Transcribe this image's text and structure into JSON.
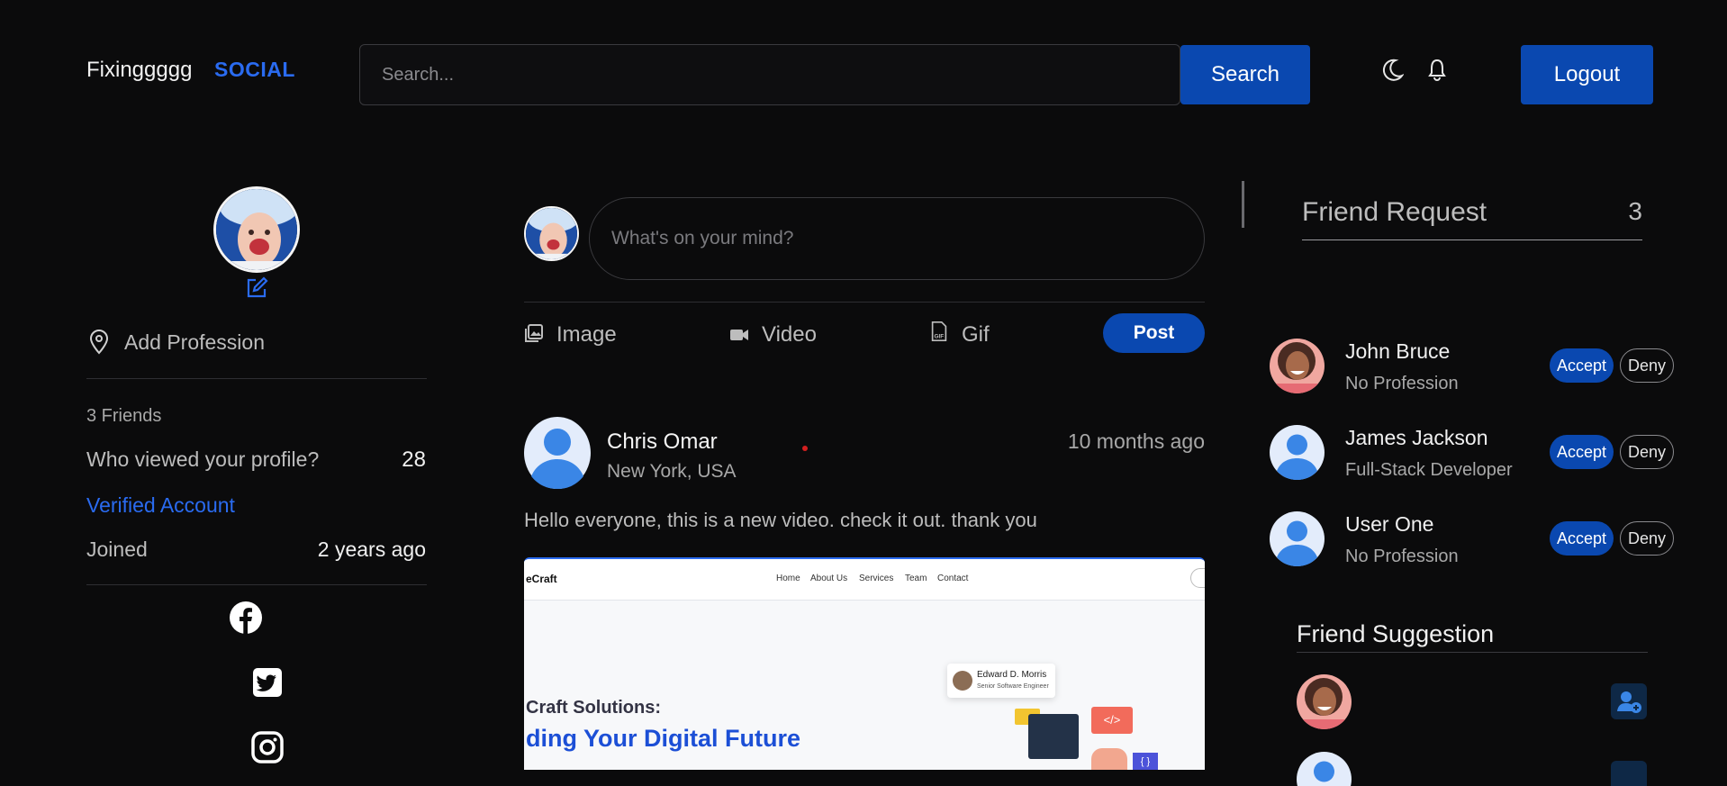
{
  "header": {
    "brand": "Fixinggggg",
    "brand_accent": "SOCIAL",
    "search_placeholder": "Search...",
    "search_button": "Search",
    "logout_button": "Logout"
  },
  "profile": {
    "add_profession": "Add Profession",
    "friends_count": "3 Friends",
    "viewed_label": "Who viewed your profile?",
    "viewed_count": "28",
    "verified": "Verified Account",
    "joined_label": "Joined",
    "joined_value": "2 years ago"
  },
  "composer": {
    "placeholder": "What's on your mind?",
    "options": [
      "Image",
      "Video",
      "Gif"
    ],
    "post_button": "Post"
  },
  "post": {
    "author": "Chris Omar",
    "location": "New York, USA",
    "time": "10 months ago",
    "text": "Hello everyone, this is a new video. check it out. thank you",
    "preview": {
      "logo": "eCraft",
      "nav": [
        "Home",
        "About Us",
        "Services",
        "Team",
        "Contact"
      ],
      "card_name": "Edward D. Morris",
      "card_role": "Senior Software Engineer",
      "headline_1": "Craft Solutions:",
      "headline_2": "ding Your Digital Future",
      "code_tag": "</>",
      "brace_tag": "{ }"
    }
  },
  "friend_requests": {
    "title": "Friend Request",
    "count": "3",
    "accept_label": "Accept",
    "deny_label": "Deny",
    "items": [
      {
        "name": "John Bruce",
        "profession": "No Profession",
        "avatar": "photo"
      },
      {
        "name": "James Jackson",
        "profession": "Full-Stack Developer",
        "avatar": "default"
      },
      {
        "name": "User One",
        "profession": "No Profession",
        "avatar": "default"
      }
    ]
  },
  "friend_suggestion": {
    "title": "Friend Suggestion"
  },
  "colors": {
    "accent": "#0a48b0",
    "link": "#2a6bf0",
    "background": "#0b0b0c"
  }
}
